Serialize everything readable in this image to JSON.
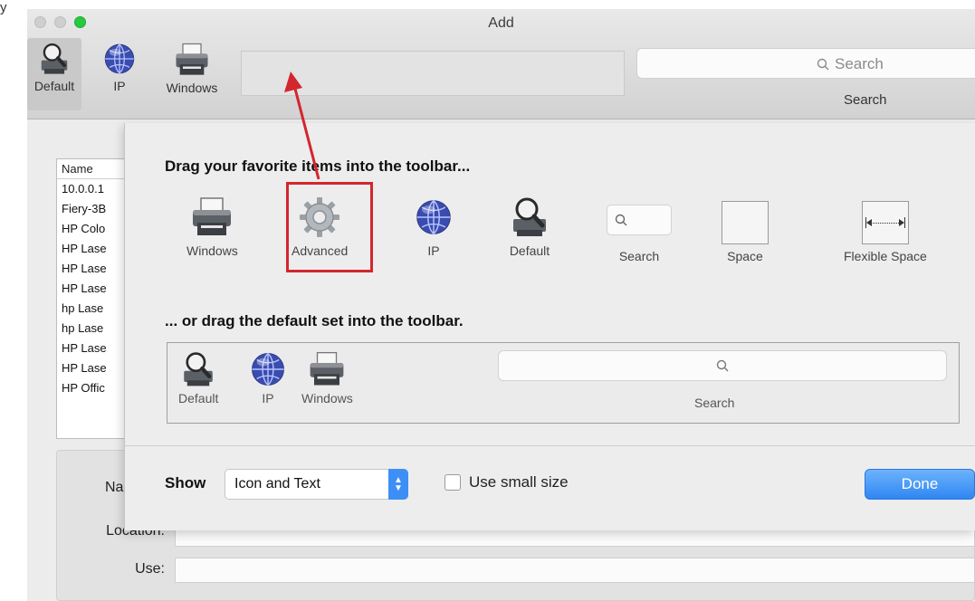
{
  "edge_text": "y",
  "window": {
    "title": "Add",
    "toolbar": [
      {
        "label": "Default",
        "icon": "magnifier-printer-icon"
      },
      {
        "label": "IP",
        "icon": "globe-icon"
      },
      {
        "label": "Windows",
        "icon": "printer-icon"
      }
    ],
    "search_placeholder": "Search",
    "search_label": "Search"
  },
  "printer_list": {
    "header": "Name",
    "rows": [
      "10.0.0.1",
      "Fiery-3B",
      "HP Colo",
      "HP Lase",
      "HP Lase",
      "HP Lase",
      "hp Lase",
      "hp Lase",
      "HP Lase",
      "HP Lase",
      "HP Offic"
    ]
  },
  "form": {
    "name_label": "Na",
    "location_label": "Location:",
    "use_label": "Use:"
  },
  "sheet": {
    "title": "Drag your favorite items into the toolbar...",
    "palette": [
      {
        "label": "Windows",
        "icon": "printer-icon"
      },
      {
        "label": "Advanced",
        "icon": "gear-icon"
      },
      {
        "label": "IP",
        "icon": "globe-icon"
      },
      {
        "label": "Default",
        "icon": "magnifier-printer-icon"
      },
      {
        "label": "Search",
        "icon": "search-icon"
      },
      {
        "label": "Space",
        "icon": "space-icon"
      },
      {
        "label": "Flexible Space",
        "icon": "flexible-space-icon"
      }
    ],
    "default_set_title": "... or drag the default set into the toolbar.",
    "default_set": [
      {
        "label": "Default",
        "icon": "magnifier-printer-icon"
      },
      {
        "label": "IP",
        "icon": "globe-icon"
      },
      {
        "label": "Windows",
        "icon": "printer-icon"
      }
    ],
    "default_set_search_label": "Search",
    "show_label": "Show",
    "show_value": "Icon and Text",
    "small_size_label": "Use small size",
    "small_size_checked": false,
    "done_label": "Done"
  },
  "colors": {
    "accent": "#2f86f2",
    "annotation": "#d3262e"
  }
}
